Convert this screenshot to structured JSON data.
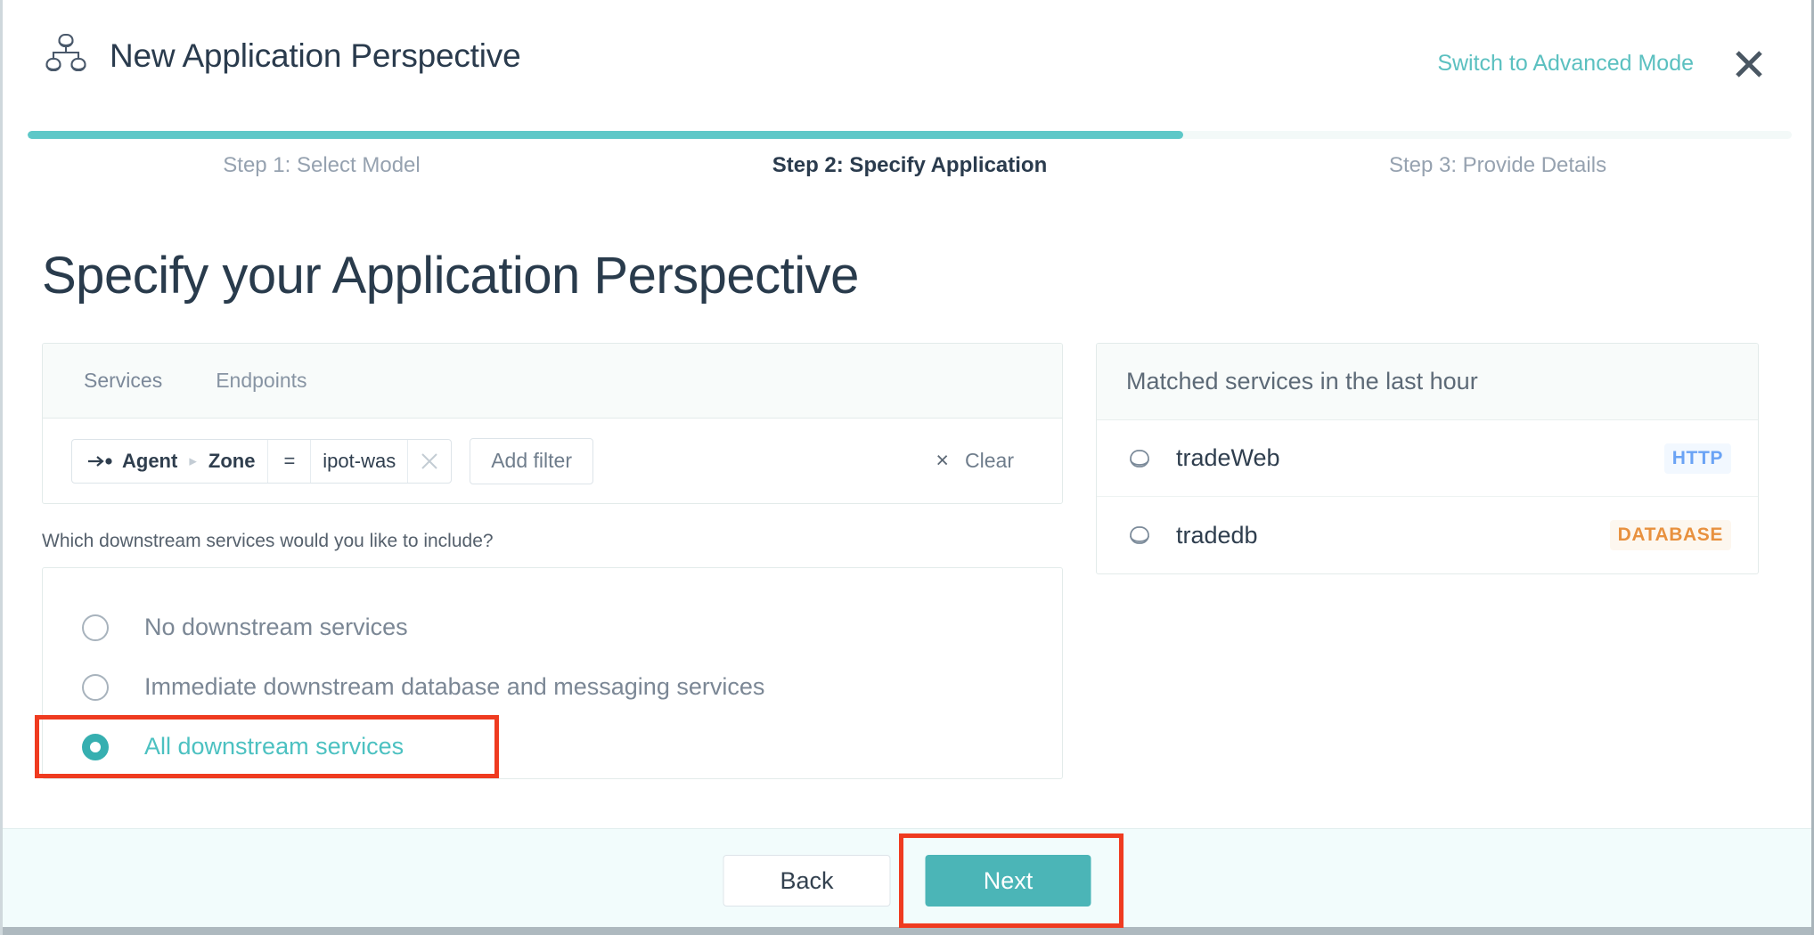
{
  "header": {
    "icon": "application-perspective-icon",
    "title": "New Application Perspective",
    "switch_mode_label": "Switch to Advanced Mode",
    "close_icon": "close-icon"
  },
  "stepper": {
    "progress_percent": 65.5,
    "steps": [
      {
        "label": "Step 1: Select Model",
        "active": false
      },
      {
        "label": "Step 2: Specify Application",
        "active": true
      },
      {
        "label": "Step 3: Provide Details",
        "active": false
      }
    ]
  },
  "page": {
    "title": "Specify your Application Perspective"
  },
  "filter_panel": {
    "tabs": [
      {
        "label": "Services",
        "selected": true
      },
      {
        "label": "Endpoints",
        "selected": false
      }
    ],
    "chip": {
      "direction_icon": "arrow-to-node-icon",
      "key": "Agent",
      "path_separator": "▸",
      "subkey": "Zone",
      "operator": "=",
      "value": "ipot-was",
      "remove_icon": "close-icon"
    },
    "add_filter_label": "Add filter",
    "clear_icon": "×",
    "clear_label": "Clear"
  },
  "downstream": {
    "question": "Which downstream services would you like to include?",
    "options": [
      {
        "label": "No downstream services",
        "selected": false
      },
      {
        "label": "Immediate downstream database and messaging services",
        "selected": false
      },
      {
        "label": "All downstream services",
        "selected": true
      }
    ]
  },
  "matched_services": {
    "header": "Matched services in the last hour",
    "rows": [
      {
        "icon": "service-node-icon",
        "name": "tradeWeb",
        "badge": "HTTP",
        "badge_type": "http"
      },
      {
        "icon": "service-node-icon",
        "name": "tradedb",
        "badge": "DATABASE",
        "badge_type": "database"
      }
    ]
  },
  "footer": {
    "back_label": "Back",
    "next_label": "Next"
  },
  "colors": {
    "accent_teal": "#4bb5b7",
    "progress_teal": "#5ec8c8",
    "link_teal": "#5bc0c0",
    "selected_radio": "#36afb0",
    "highlight_red": "#ef3b20",
    "badge_http_text": "#6aa3f5",
    "badge_http_bg": "#f2f8ff",
    "badge_database_text": "#e8913f",
    "badge_database_bg": "#fdf7ef",
    "footer_bg": "#f2fcfc",
    "heading": "#293b4c"
  }
}
